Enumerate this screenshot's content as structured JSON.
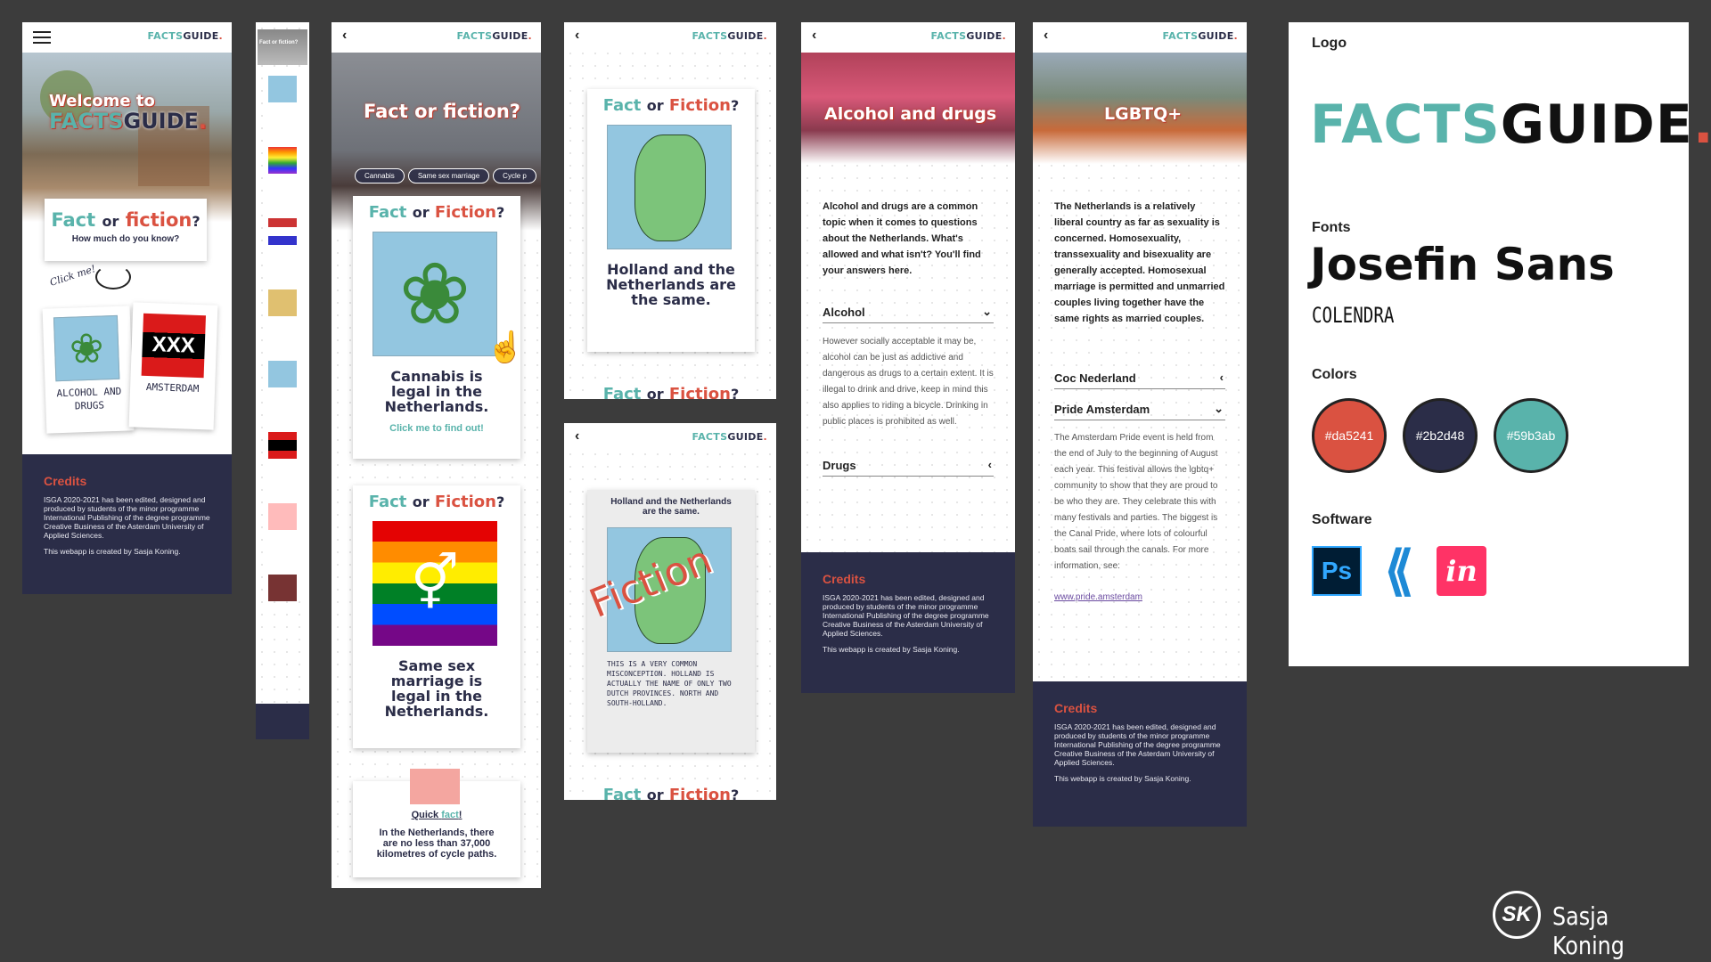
{
  "brand": {
    "a": "FACTS",
    "b": "GUIDE",
    "c": "."
  },
  "colors": {
    "red": "#da5241",
    "navy": "#2b2d48",
    "teal": "#59b3ab"
  },
  "home": {
    "welcome_a": "Welcome to",
    "welcome_b": "FACTS",
    "welcome_c": "GUIDE",
    "welcome_d": ".",
    "fact": "Fact",
    "or": "or",
    "fiction": "fiction",
    "q": "?",
    "sub": "How much do you know?",
    "click": "Click me!",
    "tiles": [
      {
        "label": "ALCOHOL AND DRUGS",
        "icon": "cannabis-leaf-icon"
      },
      {
        "label": "AMSTERDAM",
        "icon": "amsterdam-xxx-icon"
      }
    ]
  },
  "thumbnail": {
    "title": "Fact or fiction?"
  },
  "quiz": {
    "title": "Fact or fiction?",
    "tabs": [
      "Cannabis",
      "Same sex marriage",
      "Cycle p"
    ],
    "fact": "Fact",
    "or": "or",
    "fiction": "Fiction",
    "q": "?",
    "card1": "Cannabis is legal in the Netherlands.",
    "card1_cta": "Click me to find out!",
    "card2": "Same sex marriage is legal in the Netherlands.",
    "quick_a": "Quick",
    "quick_b": "fact",
    "quick_c": "!",
    "quick_text": "In the Netherlands, there are no less than 37,000 kilometres of cycle paths."
  },
  "nl": {
    "fact": "Fact",
    "or": "or",
    "fiction": "Fiction",
    "q": "?",
    "statement": "Holland and the Netherlands are the same.",
    "stamp": "Fiction",
    "answer": "THIS IS A VERY COMMON MISCONCEPTION. HOLLAND IS ACTUALLY THE NAME OF ONLY TWO DUTCH PROVINCES. NORTH AND SOUTH-HOLLAND."
  },
  "alcohol": {
    "title": "Alcohol and drugs",
    "intro": "Alcohol and drugs are a common topic when it comes to questions about the Netherlands. What's allowed and what isn't? You'll find your answers here.",
    "acc1": "Alcohol",
    "acc1_body": "However socially acceptable it may be, alcohol can be just as addictive and dangerous as drugs to a certain extent. It is illegal to drink and drive, keep in mind this also applies to riding a bicycle. Drinking in public places is prohibited as well.",
    "acc2": "Drugs"
  },
  "lgbt": {
    "title": "LGBTQ+",
    "intro": "The Netherlands is a relatively liberal country as far as sexuality is concerned. Homosexuality, transsexuality and bisexuality are generally accepted. Homosexual marriage is permitted and unmarried couples living together have the same rights as married couples.",
    "acc1": "Coc Nederland",
    "acc2": "Pride Amsterdam",
    "acc2_body": "The Amsterdam Pride event is held from the end of July to the beginning of August each year. This festival allows the lgbtq+ community to show that they are proud to be who they are. They celebrate this with many festivals and parties. The biggest is the Canal Pride, where lots of colourful boats sail through the canals. For more information, see:",
    "link": "www.pride.amsterdam"
  },
  "credits": {
    "title": "Credits",
    "text": "ISGA 2020-2021 has been edited, designed and produced by students of the minor programme International Publishing of the degree programme Creative Business of the Asterdam University of Applied Sciences.",
    "by": "This webapp is created by Sasja Koning."
  },
  "styleguide": {
    "logo_label": "Logo",
    "logo_a": "FACTS",
    "logo_b": "GUIDE",
    "logo_c": ".",
    "fonts_label": "Fonts",
    "font1": "Josefin Sans",
    "font2": "COLENDRA",
    "colors_label": "Colors",
    "swatches": [
      "#da5241",
      "#2b2d48",
      "#59b3ab"
    ],
    "software_label": "Software",
    "software": [
      {
        "name": "Ps",
        "icon": "photoshop-icon"
      },
      {
        "name": "",
        "icon": "vscode-icon"
      },
      {
        "name": "in",
        "icon": "invision-icon"
      }
    ]
  },
  "author": {
    "initials": "SK",
    "name": "Sasja Koning"
  }
}
